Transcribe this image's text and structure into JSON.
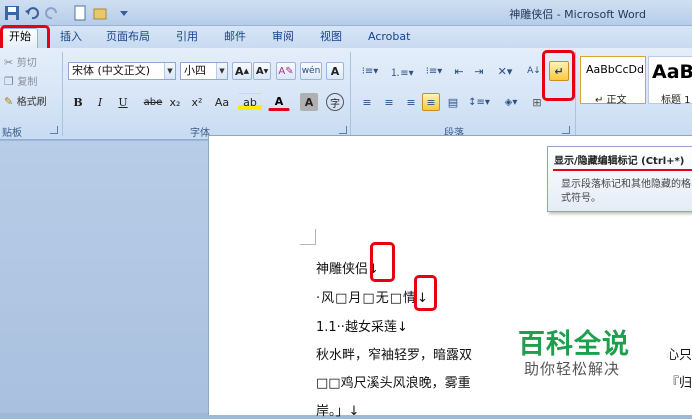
{
  "window": {
    "title": "神雕侠侣 - Microsoft Word"
  },
  "tabs": [
    "开始",
    "插入",
    "页面布局",
    "引用",
    "邮件",
    "审阅",
    "视图",
    "Acrobat"
  ],
  "clipboard": {
    "cut_label": "剪切",
    "copy_label": "复制",
    "format_painter_label": "格式刷",
    "group_label": "贴板"
  },
  "font": {
    "font_name": "宋体 (中文正文)",
    "font_size": "小四",
    "group_label": "字体",
    "bold": "B",
    "italic": "I",
    "underline": "U",
    "strikethrough": "abe",
    "subscript": "x₂",
    "superscript": "x²",
    "change_case": "Aa",
    "highlight": "ab",
    "font_color": "A",
    "char_shading": "A",
    "enclose": "字",
    "grow": "A",
    "shrink": "A"
  },
  "paragraph": {
    "group_label": "段落",
    "show_marks": "↵"
  },
  "styles": [
    {
      "sample": "AaBbCcDd",
      "name": "↵ 正文"
    },
    {
      "sample": "AaB",
      "name": "标题 1"
    }
  ],
  "tooltip": {
    "title": "显示/隐藏编辑标记 (Ctrl+*)",
    "body": "显示段落标记和其他隐藏的格式符号。"
  },
  "document": {
    "lines": [
      "神雕侠侣↓",
      "·风□月□无□情↓",
      "1.1··越女采莲↓",
      "秋水畔，窄袖轻罗，暗露双",
      "□□鸡尺溪头风浪晚，雾重",
      "岸。」↓"
    ],
    "right_fragments": [
      "心只",
      "『归"
    ]
  },
  "watermark": {
    "main": "百科全说",
    "sub": "助你轻松解决"
  },
  "colors": {
    "highlight_red": "#e60012",
    "watermark_green": "#1d9f4e",
    "ribbon_bg": "#d7e5f6"
  }
}
